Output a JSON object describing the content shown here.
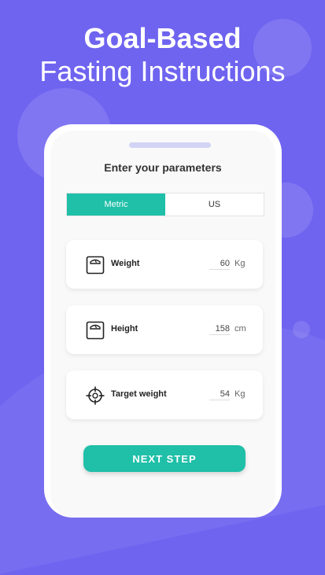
{
  "headline": {
    "line1": "Goal-Based",
    "line2": "Fasting Instructions"
  },
  "screen": {
    "title": "Enter your parameters",
    "tabs": [
      {
        "label": "Metric",
        "active": true
      },
      {
        "label": "US",
        "active": false
      }
    ],
    "fields": [
      {
        "label": "Weight",
        "value": "60",
        "unit": "Kg",
        "icon": "scale-icon"
      },
      {
        "label": "Height",
        "value": "158",
        "unit": "cm",
        "icon": "scale-icon"
      },
      {
        "label": "Target weight",
        "value": "54",
        "unit": "Kg",
        "icon": "target-icon"
      }
    ],
    "next_label": "NEXT STEP"
  },
  "colors": {
    "background": "#6f64f0",
    "accent": "#1fbfa8"
  }
}
